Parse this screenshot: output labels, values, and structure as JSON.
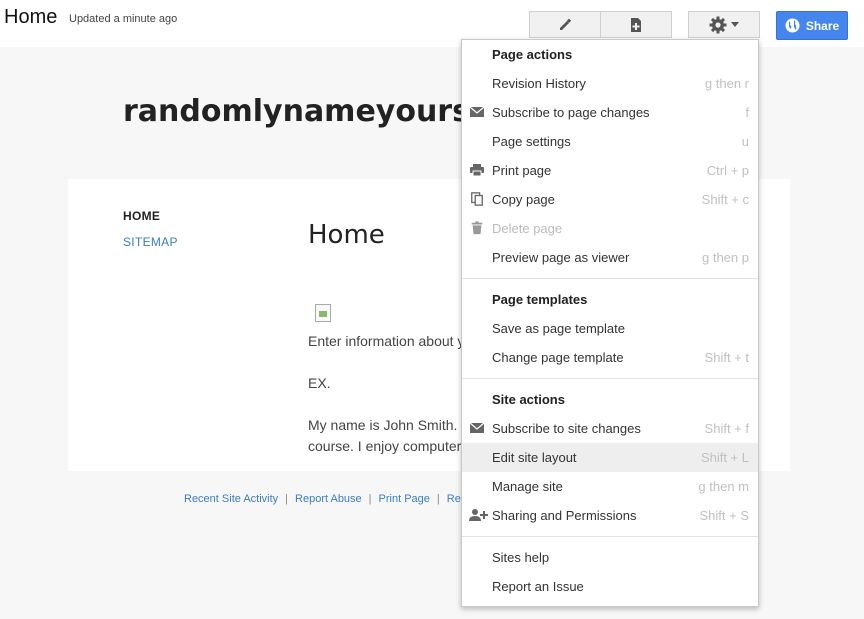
{
  "header": {
    "page_name": "Home",
    "updated": "Updated a minute ago",
    "share_label": "Share"
  },
  "site": {
    "title": "randomlynameyoursite",
    "nav": {
      "home": "HOME",
      "sitemap": "SITEMAP"
    },
    "page_title": "Home",
    "paragraphs": [
      "Enter information about yourself",
      "EX.",
      "My name is John Smith. I am a student in this",
      "course.  I enjoy computers"
    ]
  },
  "footer": {
    "links": [
      "Recent Site Activity",
      "Report Abuse",
      "Print Page",
      "Remove Access"
    ]
  },
  "menu": {
    "page_actions_heading": "Page actions",
    "page_templates_heading": "Page templates",
    "site_actions_heading": "Site actions",
    "items": [
      {
        "label": "Revision History",
        "shortcut": "g then r"
      },
      {
        "label": "Subscribe to page changes",
        "shortcut": "f",
        "icon": "envelope-icon"
      },
      {
        "label": "Page settings",
        "shortcut": "u"
      },
      {
        "label": "Print page",
        "shortcut": "Ctrl + p",
        "icon": "printer-icon"
      },
      {
        "label": "Copy page",
        "shortcut": "Shift + c",
        "icon": "copy-icon"
      },
      {
        "label": "Delete page",
        "shortcut": "",
        "icon": "trash-icon",
        "disabled": true
      },
      {
        "label": "Preview page as viewer",
        "shortcut": "g then p"
      },
      {
        "label": "Save as page template",
        "shortcut": ""
      },
      {
        "label": "Change page template",
        "shortcut": "Shift + t"
      },
      {
        "label": "Subscribe to site changes",
        "shortcut": "Shift + f",
        "icon": "envelope-icon"
      },
      {
        "label": "Edit site layout",
        "shortcut": "Shift + L",
        "highlight": true
      },
      {
        "label": "Manage site",
        "shortcut": "g then m"
      },
      {
        "label": "Sharing and Permissions",
        "shortcut": "Shift + S",
        "icon": "add-person-icon"
      },
      {
        "label": "Sites help",
        "shortcut": ""
      },
      {
        "label": "Report an Issue",
        "shortcut": ""
      }
    ]
  },
  "colors": {
    "share_blue": "#4585ee",
    "link_blue": "#3d7cc4",
    "highlight": "#eeeeee"
  }
}
